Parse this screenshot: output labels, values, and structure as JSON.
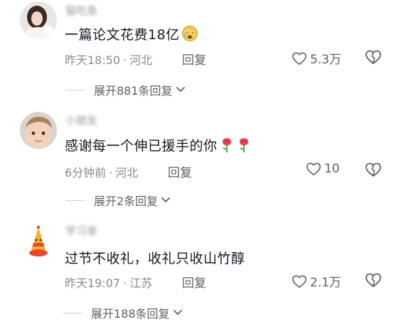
{
  "comments": [
    {
      "username": "猫吃鱼",
      "text": "一篇论文花费18亿",
      "emoji": "crying-face",
      "time": "昨天18:50",
      "location": "河北",
      "reply_label": "回复",
      "likes": "5.3万",
      "expand_label": "展开881条回复"
    },
    {
      "username": "小朋友",
      "text": "感谢每一个伸已援手的你",
      "emoji": "rose",
      "time": "6分钟前",
      "location": "河北",
      "reply_label": "回复",
      "likes": "10",
      "expand_label": "展开2条回复"
    },
    {
      "username": "学习者",
      "text": "过节不收礼，收礼只收山竹醇",
      "emoji": "",
      "time": "昨天19:07",
      "location": "江苏",
      "reply_label": "回复",
      "likes": "2.1万",
      "expand_label": "展开188条回复"
    }
  ],
  "separator": "·",
  "colors": {
    "text": "#161823",
    "meta": "#8a8b91",
    "action": "#5f6068"
  }
}
